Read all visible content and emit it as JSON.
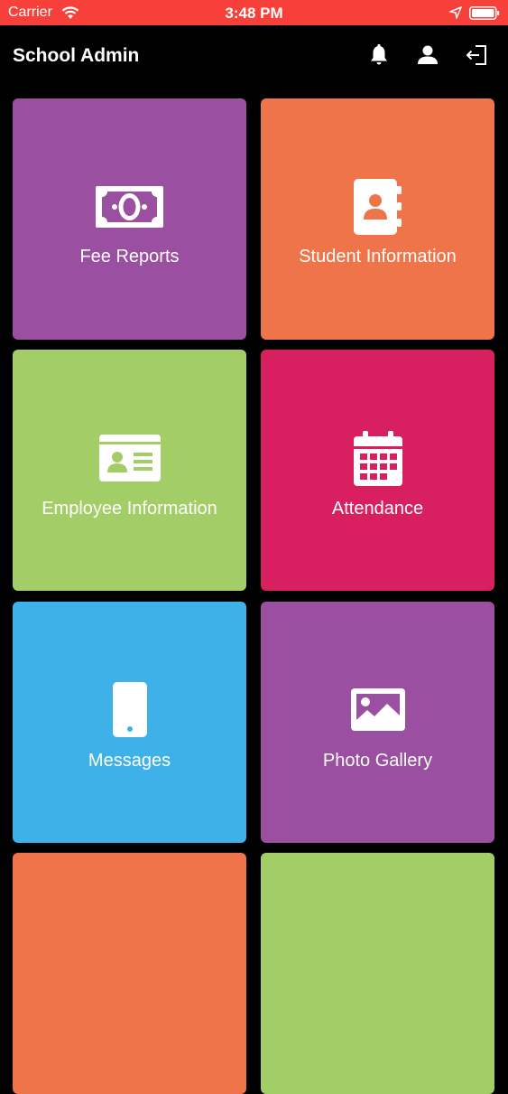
{
  "status_bar": {
    "carrier": "Carrier",
    "time": "3:48 PM"
  },
  "header": {
    "title": "School Admin"
  },
  "tiles": [
    {
      "label": "Fee Reports",
      "icon": "money-bill-icon",
      "color": "#9b4fa0"
    },
    {
      "label": "Student Information",
      "icon": "address-book-icon",
      "color": "#f0744a"
    },
    {
      "label": "Employee Information",
      "icon": "id-card-icon",
      "color": "#a3cd67"
    },
    {
      "label": "Attendance",
      "icon": "calendar-icon",
      "color": "#d81f5f"
    },
    {
      "label": "Messages",
      "icon": "mobile-phone-icon",
      "color": "#3eb1e8"
    },
    {
      "label": "Photo Gallery",
      "icon": "image-icon",
      "color": "#9b4fa0"
    },
    {
      "label": "",
      "icon": "",
      "color": "#f0744a"
    },
    {
      "label": "",
      "icon": "",
      "color": "#a3cd67"
    }
  ]
}
